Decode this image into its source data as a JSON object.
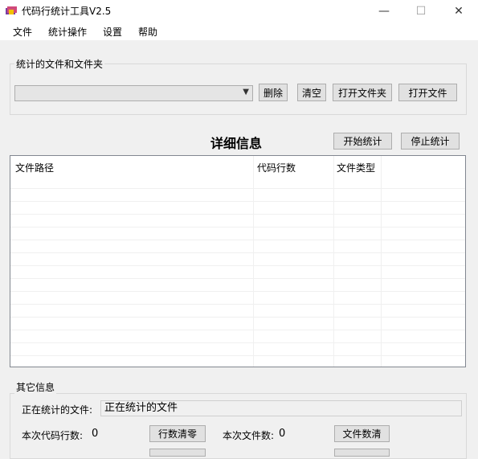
{
  "window": {
    "title": "代码行统计工具V2.5",
    "minimize": "—",
    "maximize": "☐",
    "close": "✕"
  },
  "menu": [
    "文件",
    "统计操作",
    "设置",
    "帮助"
  ],
  "files_group": {
    "title": "统计的文件和文件夹",
    "combo_value": "",
    "buttons": {
      "delete": "删除",
      "clear": "清空",
      "open_folder": "打开文件夹",
      "open_file": "打开文件"
    }
  },
  "detail": {
    "title": "详细信息",
    "start_button": "开始统计",
    "stop_button": "停止统计",
    "columns": [
      "文件路径",
      "代码行数",
      "文件类型"
    ],
    "rows": []
  },
  "other_group": {
    "title": "其它信息",
    "current_file_label": "正在统计的文件:",
    "current_file_value": "正在统计的文件",
    "line_count_label": "本次代码行数:",
    "line_count_value": "0",
    "reset_lines_button": "行数清零",
    "file_count_label": "本次文件数:",
    "file_count_value": "0",
    "reset_files_button": "文件数清"
  }
}
